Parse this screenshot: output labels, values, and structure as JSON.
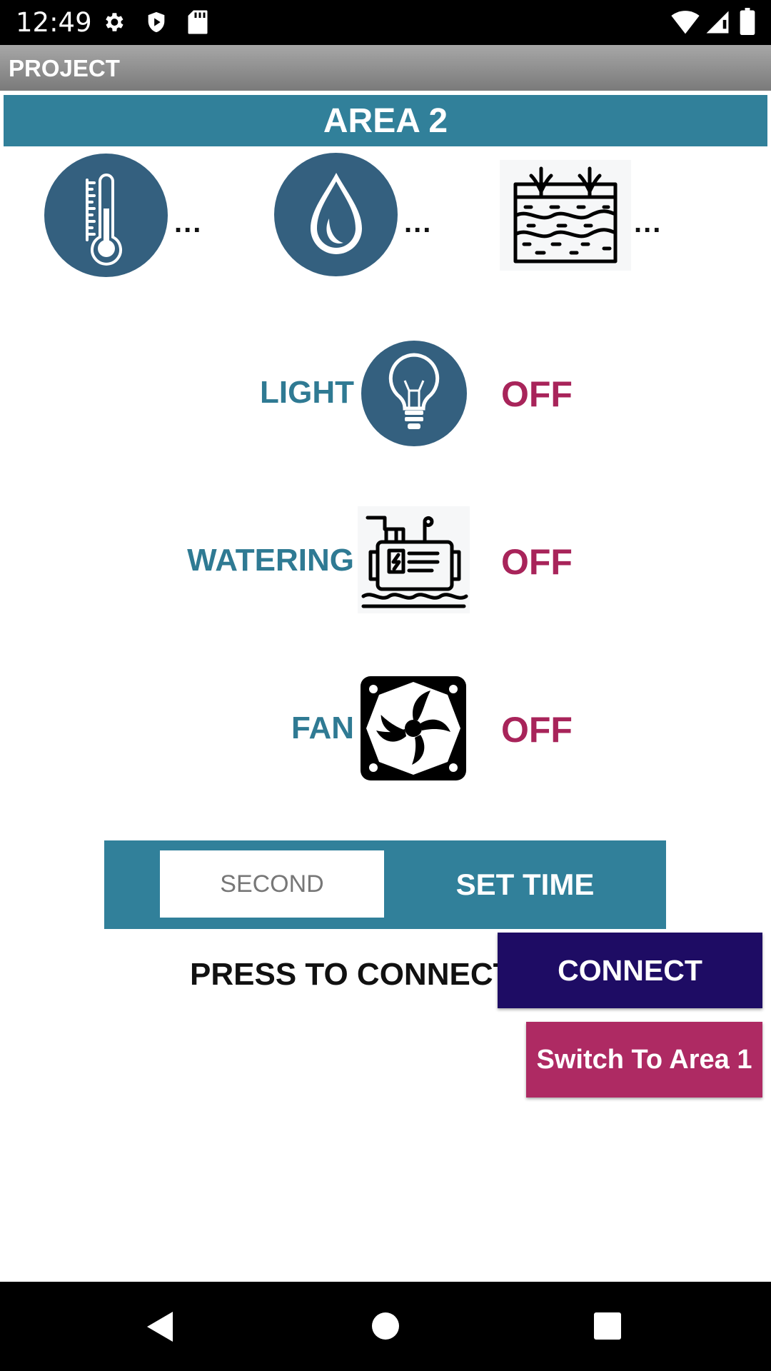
{
  "status_bar": {
    "time": "12:49"
  },
  "app_bar": {
    "title": "PROJECT"
  },
  "area": {
    "title": "AREA 2"
  },
  "sensors": [
    {
      "name": "temperature",
      "value": "..."
    },
    {
      "name": "humidity",
      "value": "..."
    },
    {
      "name": "soil-moisture",
      "value": "..."
    }
  ],
  "devices": [
    {
      "label": "LIGHT",
      "state": "OFF",
      "icon": "light-bulb-icon"
    },
    {
      "label": "WATERING",
      "state": "OFF",
      "icon": "water-pump-icon"
    },
    {
      "label": "FAN",
      "state": "OFF",
      "icon": "fan-icon"
    }
  ],
  "timer": {
    "placeholder": "SECOND",
    "set_label": "SET TIME"
  },
  "connection": {
    "prompt": "PRESS TO CONNECT",
    "connect_label": "CONNECT"
  },
  "switch": {
    "label": "Switch To Area 1"
  },
  "colors": {
    "header": "#31809a",
    "icon_bg": "#34607f",
    "state_off": "#a8245a",
    "connect": "#1e0c64",
    "switch": "#ae2a63"
  }
}
